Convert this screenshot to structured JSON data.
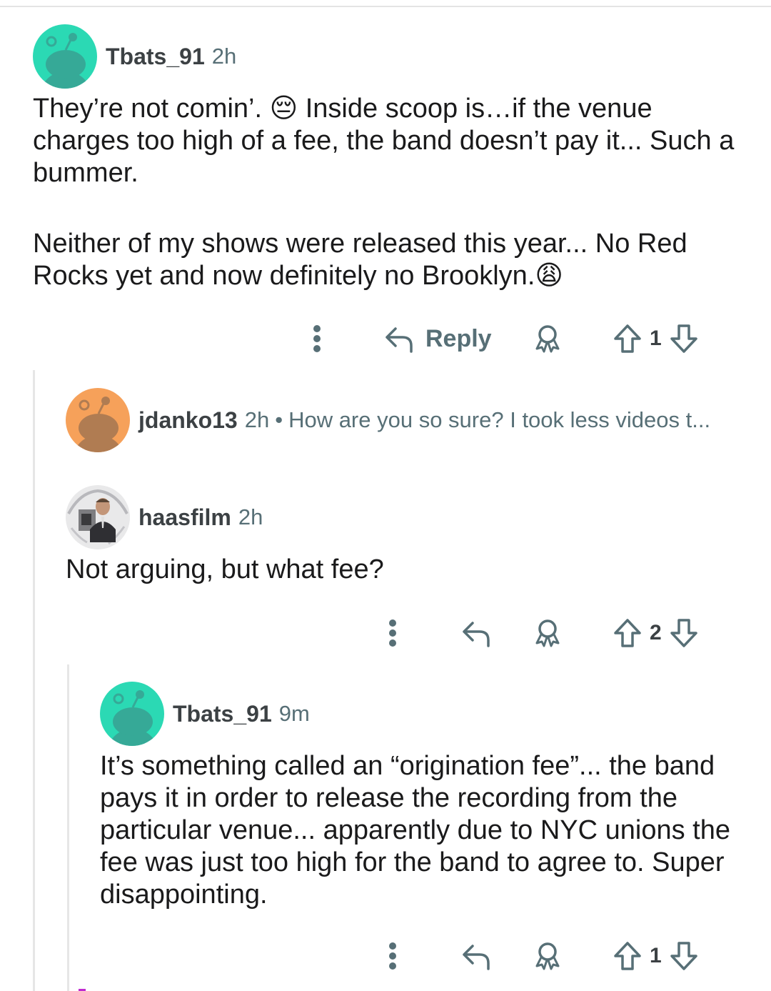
{
  "comments": [
    {
      "author": "Tbats_91",
      "time": "2h",
      "avatar_color": "#2bd9b4",
      "paragraphs": [
        "They’re not comin’. 😔 Inside scoop is…if the venue charges too high of a fee, the band doesn’t pay it... Such a bummer.",
        "Neither of my shows were released this year... No Red Rocks yet and now definitely no Brooklyn.😩"
      ],
      "reply_label": "Reply",
      "votes": "1"
    },
    {
      "author": "jdanko13",
      "time": "2h",
      "separator": "•",
      "preview": "How are you so sure? I took less videos t...",
      "avatar_color": "#f6a15a"
    },
    {
      "author": "haasfilm",
      "time": "2h",
      "text": "Not arguing, but what fee?",
      "votes": "2"
    },
    {
      "author": "Tbats_91",
      "time": "9m",
      "avatar_color": "#2bd9b4",
      "text": "It’s something called an “origination fee”... the band pays it in order to release the recording from the particular venue... apparently due to NYC unions the fee was just too high for the band to agree to. Super disappointing.",
      "votes": "1"
    }
  ],
  "icons": {
    "more": "more-vertical-icon",
    "reply": "reply-arrow-icon",
    "award": "award-icon",
    "upvote": "upvote-arrow-icon",
    "downvote": "downvote-arrow-icon",
    "snoo": "snoo-avatar-icon"
  },
  "colors": {
    "icon_gray": "#576f76",
    "thread_line": "#e6e6e6"
  }
}
